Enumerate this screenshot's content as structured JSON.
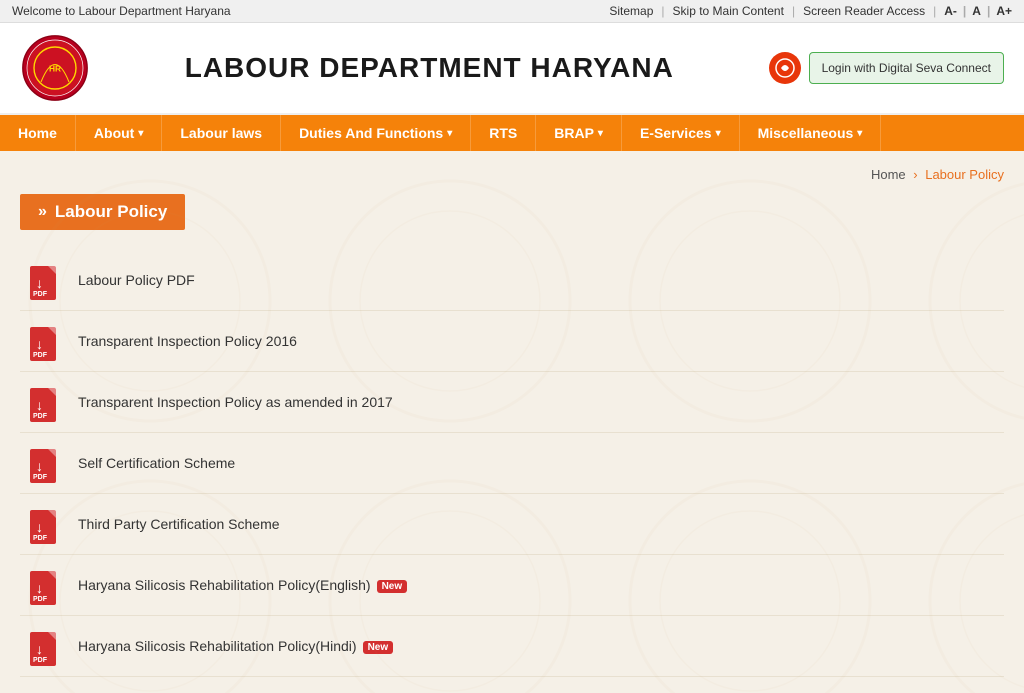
{
  "topbar": {
    "welcome": "Welcome to Labour Department Haryana",
    "sitemap": "Sitemap",
    "skip": "Skip to Main Content",
    "screen_reader": "Screen Reader Access",
    "font_decrease": "A-",
    "font_normal": "A",
    "font_increase": "A+"
  },
  "header": {
    "title": "LABOUR DEPARTMENT HARYANA",
    "login_btn": "Login with Digital Seva Connect"
  },
  "nav": {
    "items": [
      {
        "label": "Home",
        "has_arrow": false
      },
      {
        "label": "About",
        "has_arrow": true
      },
      {
        "label": "Labour laws",
        "has_arrow": false
      },
      {
        "label": "Duties And Functions",
        "has_arrow": true
      },
      {
        "label": "RTS",
        "has_arrow": false
      },
      {
        "label": "BRAP",
        "has_arrow": true
      },
      {
        "label": "E-Services",
        "has_arrow": true
      },
      {
        "label": "Miscellaneous",
        "has_arrow": true
      }
    ]
  },
  "breadcrumb": {
    "home": "Home",
    "current": "Labour Policy"
  },
  "page_title": "Labour Policy",
  "policies": [
    {
      "name": "Labour Policy PDF",
      "is_new": false
    },
    {
      "name": "Transparent Inspection Policy 2016",
      "is_new": false
    },
    {
      "name": "Transparent Inspection Policy as amended in 2017",
      "is_new": false
    },
    {
      "name": "Self Certification Scheme",
      "is_new": false
    },
    {
      "name": "Third Party Certification Scheme",
      "is_new": false
    },
    {
      "name": "Haryana Silicosis Rehabilitation Policy(English)",
      "is_new": true
    },
    {
      "name": "Haryana Silicosis Rehabilitation Policy(Hindi)",
      "is_new": true
    }
  ],
  "new_badge_text": "New"
}
